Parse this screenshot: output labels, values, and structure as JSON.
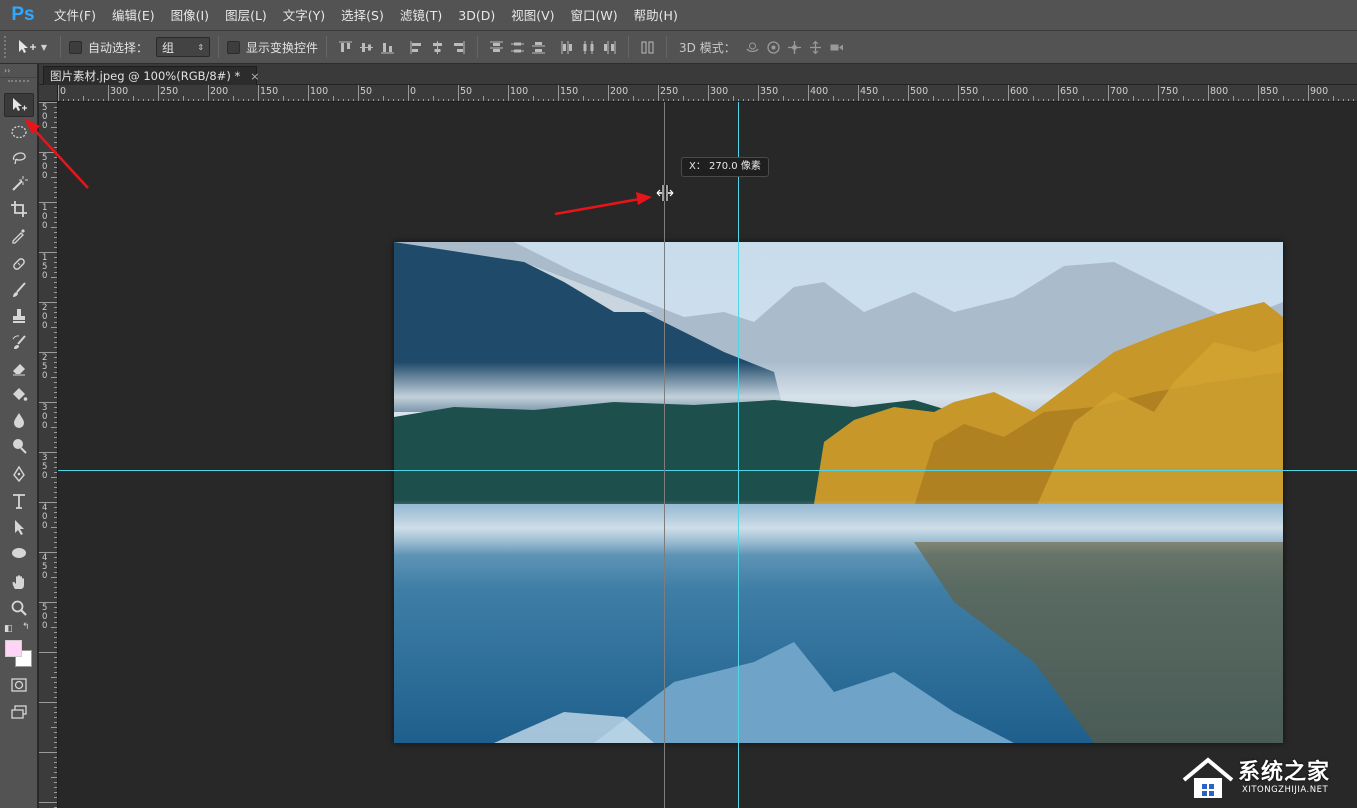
{
  "app": {
    "logo": "Ps"
  },
  "menu": [
    "文件(F)",
    "编辑(E)",
    "图像(I)",
    "图层(L)",
    "文字(Y)",
    "选择(S)",
    "滤镜(T)",
    "3D(D)",
    "视图(V)",
    "窗口(W)",
    "帮助(H)"
  ],
  "options": {
    "auto_select_label": "自动选择：",
    "auto_select_value": "组",
    "show_transform_label": "显示变换控件",
    "mode_3d_label": "3D 模式："
  },
  "toolbar": {
    "header": "››",
    "tools": [
      "move-tool",
      "elliptical-marquee-tool",
      "lasso-tool",
      "magic-wand-tool",
      "crop-tool",
      "eyedropper-tool",
      "spot-healing-tool",
      "brush-tool",
      "clone-stamp-tool",
      "history-brush-tool",
      "eraser-tool",
      "paint-bucket-tool",
      "blur-tool",
      "dodge-tool",
      "pen-tool",
      "type-tool",
      "path-selection-tool",
      "ellipse-tool",
      "hand-tool",
      "zoom-tool"
    ],
    "foreground_color": "#ffd4f5",
    "background_color": "#ffffff"
  },
  "document": {
    "tab_title": "图片素材.jpeg @ 100%(RGB/8#) *",
    "tab_close": "×"
  },
  "ruler_h": [
    "0",
    "300",
    "250",
    "200",
    "150",
    "100",
    "50",
    "0",
    "50",
    "100",
    "150",
    "200",
    "250",
    "300",
    "350",
    "400",
    "450",
    "500",
    "550",
    "600",
    "650",
    "700",
    "750",
    "800",
    "850",
    "900"
  ],
  "ruler_v": [
    "5",
    "0",
    "0",
    "5",
    "0",
    "0",
    "1",
    "0",
    "0",
    "1",
    "5",
    "0",
    "2",
    "0",
    "0",
    "2",
    "5",
    "0",
    "3",
    "0",
    "0",
    "3",
    "5",
    "0",
    "4",
    "0",
    "0",
    "4",
    "5",
    "0",
    "5",
    "0",
    "0"
  ],
  "tooltip": {
    "text": "X： 270.0 像素"
  },
  "watermark": {
    "title": "系统之家",
    "url": "XITONGZHIJIA.NET"
  },
  "colors": {
    "guide": "#4fd5e6",
    "ps_blue": "#31a8ff",
    "annotation": "#e8141a"
  }
}
